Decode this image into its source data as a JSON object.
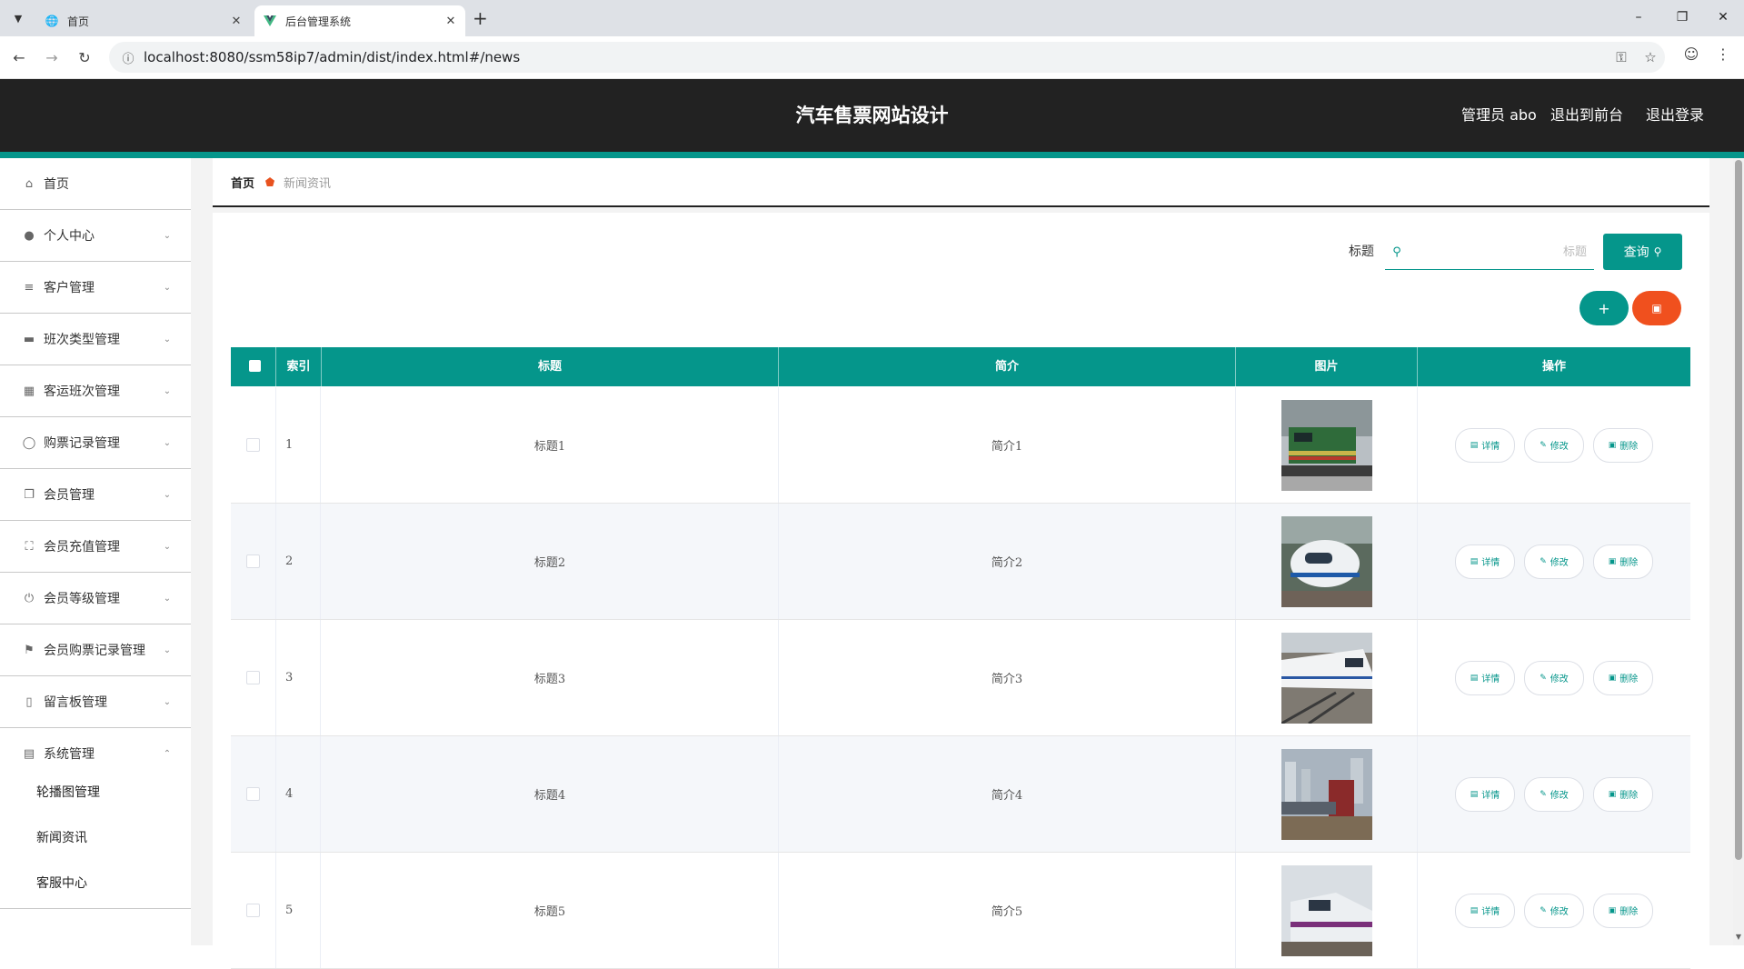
{
  "browser": {
    "tabs": [
      {
        "title": "首页",
        "active": false
      },
      {
        "title": "后台管理系统",
        "active": true
      }
    ],
    "url": "localhost:8080/ssm58ip7/admin/dist/index.html#/news"
  },
  "header": {
    "title": "汽车售票网站设计",
    "user_label": "管理员 abo",
    "to_front_label": "退出到前台",
    "logout_label": "退出登录",
    "bg_color": "#222222",
    "accent_color": "#05968b"
  },
  "sidebar": {
    "items": [
      {
        "label": "首页",
        "icon": "home-icon",
        "expandable": false
      },
      {
        "label": "个人中心",
        "icon": "user-icon",
        "expandable": true
      },
      {
        "label": "客户管理",
        "icon": "sliders-icon",
        "expandable": true
      },
      {
        "label": "班次类型管理",
        "icon": "ticket-icon",
        "expandable": true
      },
      {
        "label": "客运班次管理",
        "icon": "grid-icon",
        "expandable": true
      },
      {
        "label": "购票记录管理",
        "icon": "compass-icon",
        "expandable": true
      },
      {
        "label": "会员管理",
        "icon": "copy-icon",
        "expandable": true
      },
      {
        "label": "会员充值管理",
        "icon": "fullscreen-icon",
        "expandable": true
      },
      {
        "label": "会员等级管理",
        "icon": "power-icon",
        "expandable": true
      },
      {
        "label": "会员购票记录管理",
        "icon": "flag-icon",
        "expandable": true
      },
      {
        "label": "留言板管理",
        "icon": "phone-icon",
        "expandable": true
      },
      {
        "label": "系统管理",
        "icon": "monitor-icon",
        "expandable": true,
        "expanded": true
      }
    ],
    "sub_items": [
      "轮播图管理",
      "新闻资讯",
      "客服中心"
    ]
  },
  "breadcrumb": {
    "home": "首页",
    "current": "新闻资讯"
  },
  "search": {
    "label": "标题",
    "placeholder": "标题",
    "value": "",
    "query_label": "查询"
  },
  "actions": {
    "add_label": "+",
    "delete_icon": "trash-icon"
  },
  "table": {
    "columns": [
      "索引",
      "标题",
      "简介",
      "图片",
      "操作"
    ],
    "rows": [
      {
        "index": "1",
        "title": "标题1",
        "intro": "简介1"
      },
      {
        "index": "2",
        "title": "标题2",
        "intro": "简介2"
      },
      {
        "index": "3",
        "title": "标题3",
        "intro": "简介3"
      },
      {
        "index": "4",
        "title": "标题4",
        "intro": "简介4"
      },
      {
        "index": "5",
        "title": "标题5",
        "intro": "简介5"
      }
    ],
    "op_labels": {
      "detail": "详情",
      "edit": "修改",
      "delete": "删除"
    },
    "header_color": "#05968b",
    "delete_color": "#f0501e"
  }
}
